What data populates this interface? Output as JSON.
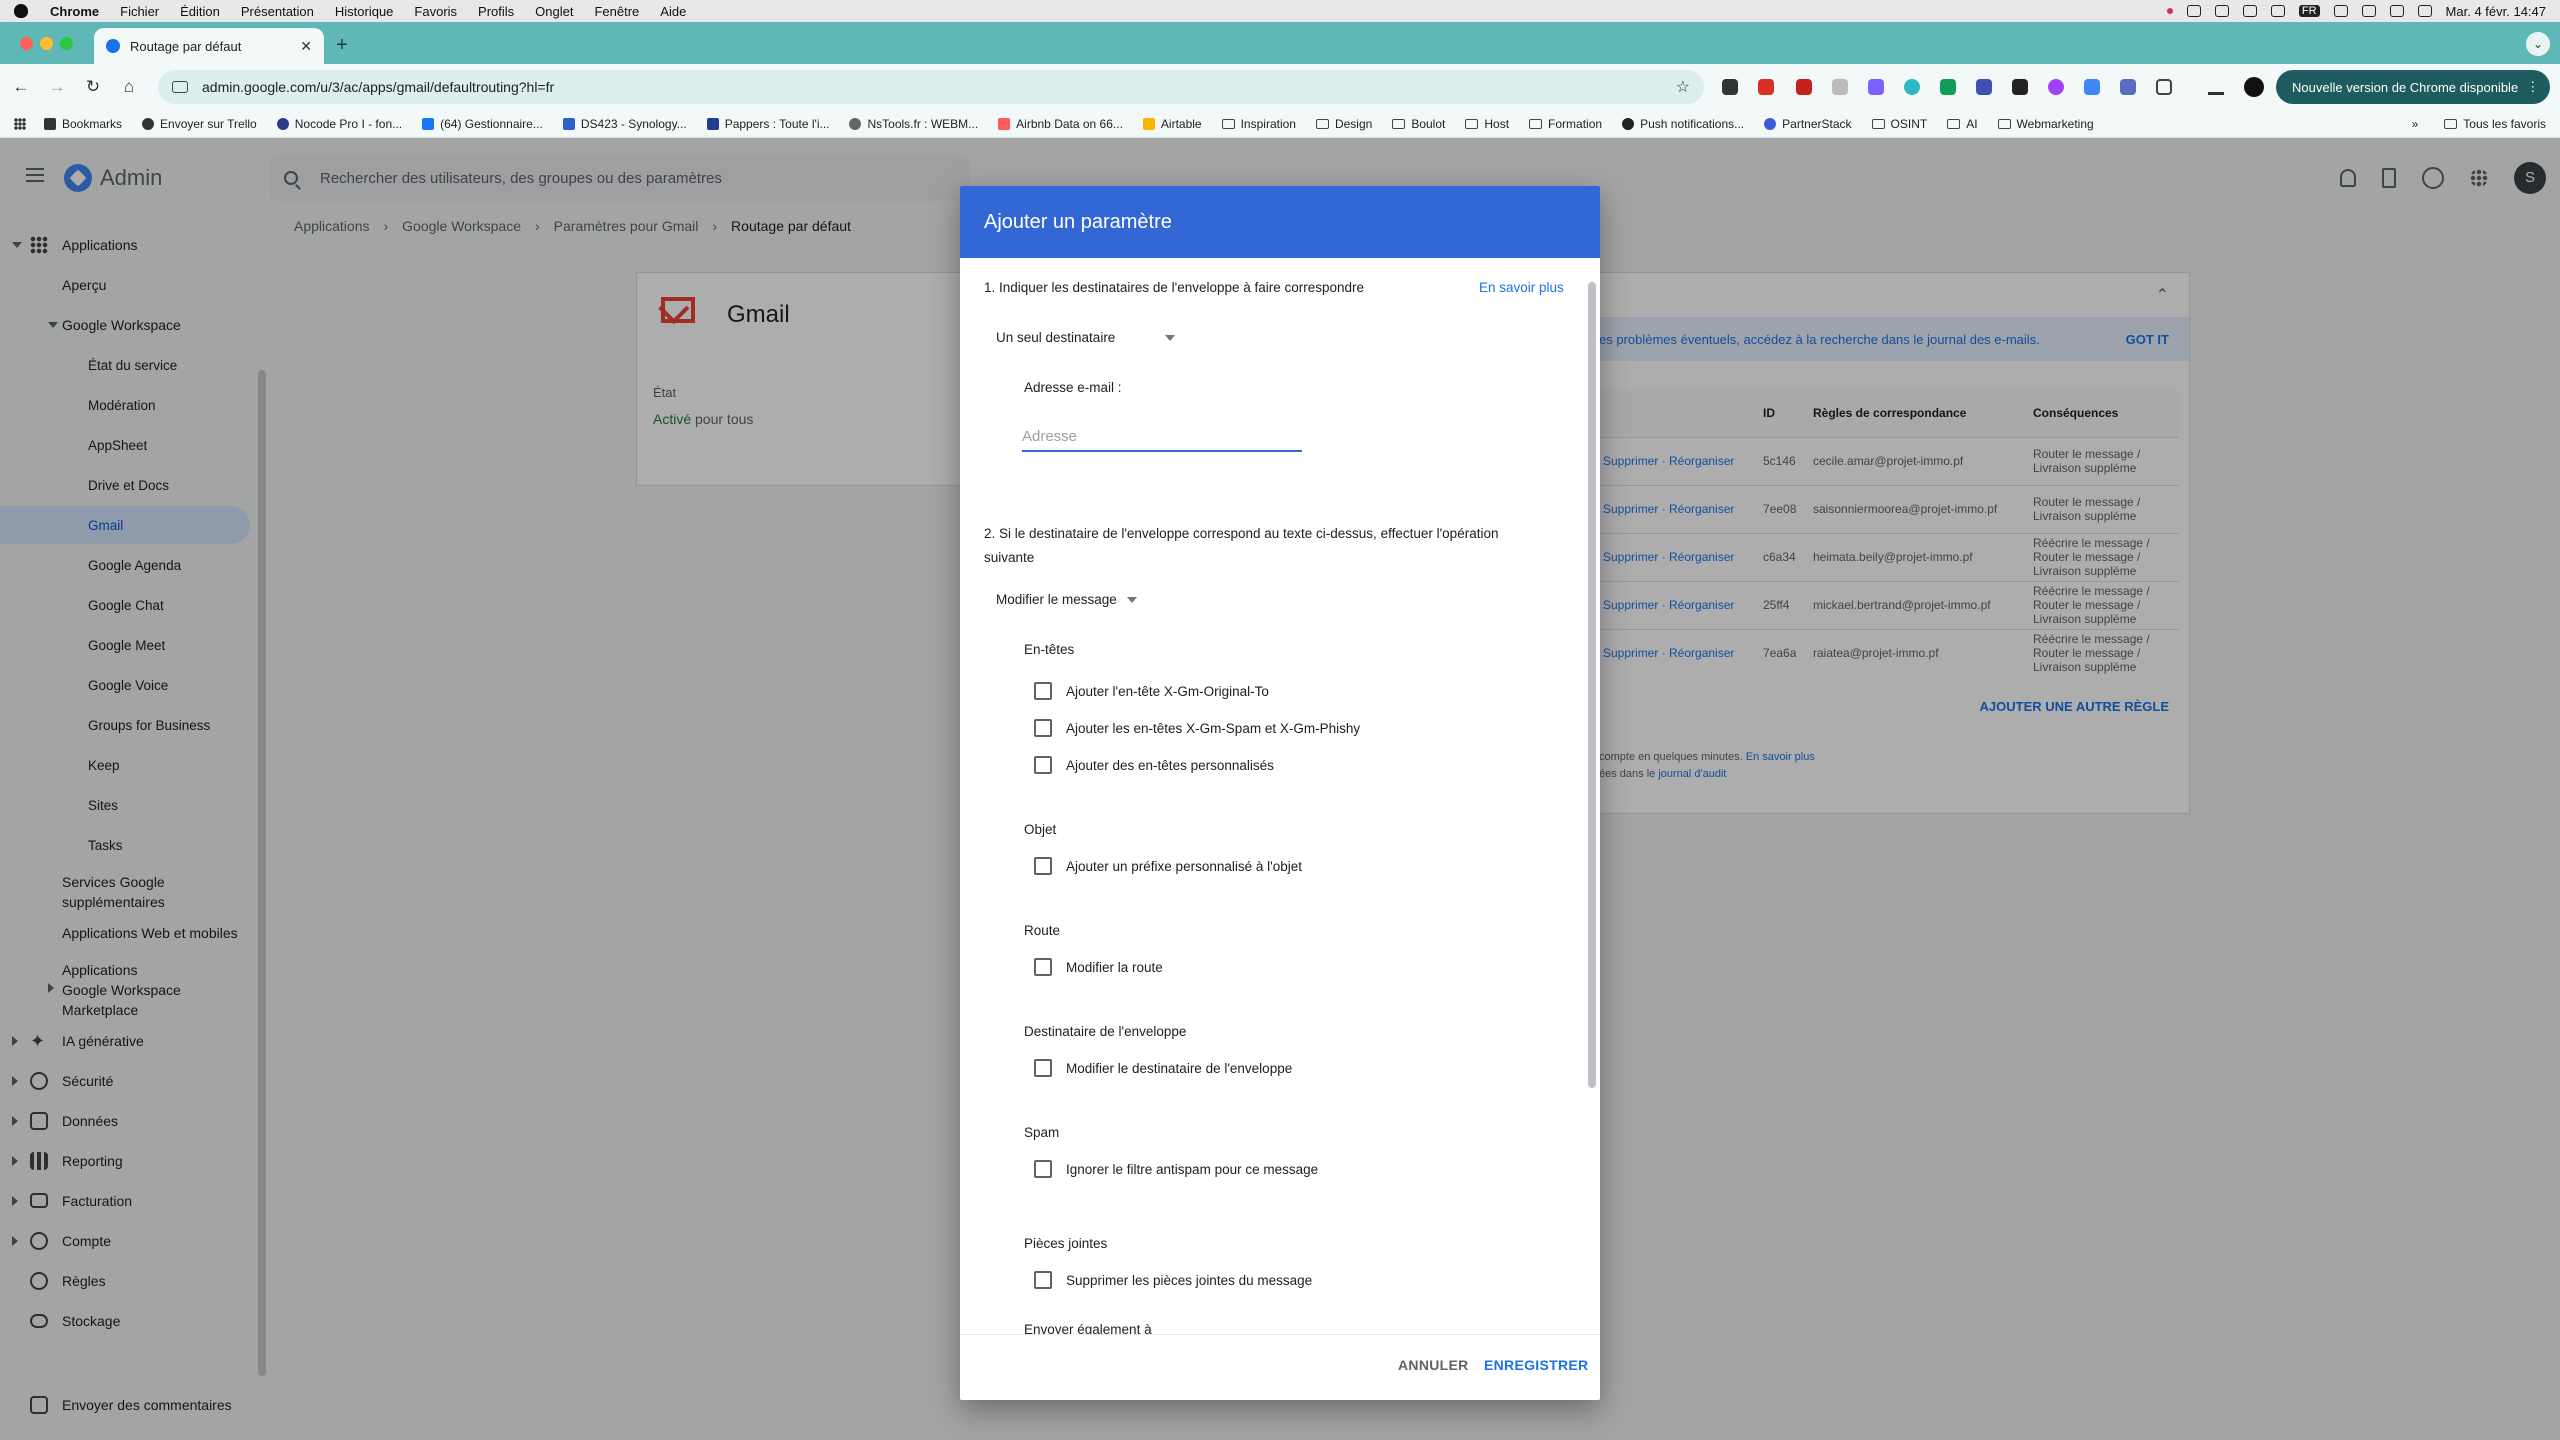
{
  "menubar": {
    "app": "Chrome",
    "items": [
      "Fichier",
      "Édition",
      "Présentation",
      "Historique",
      "Favoris",
      "Profils",
      "Onglet",
      "Fenêtre",
      "Aide"
    ],
    "lang": "FR",
    "datetime": "Mar. 4 févr. 14:47"
  },
  "browser": {
    "tab_title": "Routage par défaut",
    "url": "admin.google.com/u/3/ac/apps/gmail/defaultrouting?hl=fr",
    "update_label": "Nouvelle version de Chrome disponible",
    "bookmarks": [
      "Bookmarks",
      "Envoyer sur Trello",
      "Nocode Pro I - fon...",
      "(64) Gestionnaire...",
      "DS423 - Synology...",
      "Pappers : Toute l'i...",
      "NsTools.fr : WEBM...",
      "Airbnb Data on 66...",
      "Airtable",
      "Inspiration",
      "Design",
      "Boulot",
      "Host",
      "Formation",
      "Push notifications...",
      "PartnerStack",
      "OSINT",
      "AI",
      "Webmarketing"
    ],
    "all_bookmarks": "Tous les favoris",
    "chevron": "»"
  },
  "appbar": {
    "title": "Admin",
    "search_placeholder": "Rechercher des utilisateurs, des groupes ou des paramètres",
    "avatar_initial": "S"
  },
  "sidebar": {
    "applications": "Applications",
    "apercu": "Aperçu",
    "google_workspace": "Google Workspace",
    "gw_items": [
      "État du service",
      "Modération",
      "AppSheet",
      "Drive et Docs",
      "Gmail",
      "Google Agenda",
      "Google Chat",
      "Google Meet",
      "Google Voice",
      "Groups for Business",
      "Keep",
      "Sites",
      "Tasks"
    ],
    "services_sup_1": "Services Google",
    "services_sup_2": "supplémentaires",
    "web_mobile": "Applications Web et mobiles",
    "marketplace_1": "Applications",
    "marketplace_2": "Google Workspace",
    "marketplace_3": "Marketplace",
    "sections": [
      "IA générative",
      "Sécurité",
      "Données",
      "Reporting",
      "Facturation",
      "Compte",
      "Règles",
      "Stockage"
    ],
    "feedback": "Envoyer des commentaires"
  },
  "breadcrumb": {
    "items": [
      "Applications",
      "Google Workspace",
      "Paramètres pour Gmail"
    ],
    "current": "Routage par défaut",
    "separator": "›"
  },
  "gmail_card": {
    "title": "Gmail",
    "etat_label": "État",
    "etat_status": "Activé",
    "etat_suffix": " pour tous"
  },
  "rules_card": {
    "banner_text": "es problèmes éventuels, accédez à la recherche dans le journal des e-mails.",
    "gotit": "GOT IT",
    "headers": [
      "",
      "ID",
      "Règles de correspondance",
      "Conséquences"
    ],
    "rows": [
      {
        "action": "Supprimer · Réorganiser",
        "id": "5c146",
        "match": "cecile.amar@projet-immo.pf",
        "consequence": "Router le message / Livraison suppléme"
      },
      {
        "action": "Supprimer · Réorganiser",
        "id": "7ee08",
        "match": "saisonniermoorea@projet-immo.pf",
        "consequence": "Router le message / Livraison suppléme"
      },
      {
        "action": "Supprimer · Réorganiser",
        "id": "c6a34",
        "match": "heimata.beily@projet-immo.pf",
        "consequence": "Réécrire le message / Router le message / Livraison suppléme"
      },
      {
        "action": "Supprimer · Réorganiser",
        "id": "25ff4",
        "match": "mickael.bertrand@projet-immo.pf",
        "consequence": "Réécrire le message / Router le message / Livraison suppléme"
      },
      {
        "action": "Supprimer · Réorganiser",
        "id": "7ea6a",
        "match": "raiatea@projet-immo.pf",
        "consequence": "Réécrire le message / Router le message / Livraison suppléme"
      }
    ],
    "add_rule": "AJOUTER UNE AUTRE RÈGLE",
    "foot_1": "compte en quelques minutes. ",
    "foot_1_link": "En savoir plus",
    "foot_2": "ées dans le ",
    "foot_2_link": "journal d'audit"
  },
  "dialog": {
    "title": "Ajouter un paramètre",
    "step1": "1. Indiquer les destinataires de l'enveloppe à faire correspondre",
    "learn_more": "En savoir plus",
    "recipient_mode": "Un seul destinataire",
    "email_label": "Adresse e-mail :",
    "email_value": "",
    "email_placeholder": "Adresse",
    "step2_line1": "2. Si le destinataire de l'enveloppe correspond au texte ci-dessus, effectuer l'opération",
    "step2_line2": "suivante",
    "operation": "Modifier le message",
    "sections": {
      "entetes": "En-têtes",
      "objet": "Objet",
      "route": "Route",
      "destinataire": "Destinataire de l'enveloppe",
      "spam": "Spam",
      "pieces": "Pièces jointes",
      "envoyer": "Envoyer également à"
    },
    "options": {
      "original_to": "Ajouter l'en-tête X-Gm-Original-To",
      "spam_phishy": "Ajouter les en-têtes X-Gm-Spam et X-Gm-Phishy",
      "custom_headers": "Ajouter des en-têtes personnalisés",
      "subject_prefix": "Ajouter un préfixe personnalisé à l'objet",
      "change_route": "Modifier la route",
      "change_recipient": "Modifier le destinataire de l'enveloppe",
      "bypass_spam": "Ignorer le filtre antispam pour ce message",
      "remove_attachments": "Supprimer les pièces jointes du message"
    },
    "cancel": "ANNULER",
    "save": "ENREGISTRER"
  }
}
